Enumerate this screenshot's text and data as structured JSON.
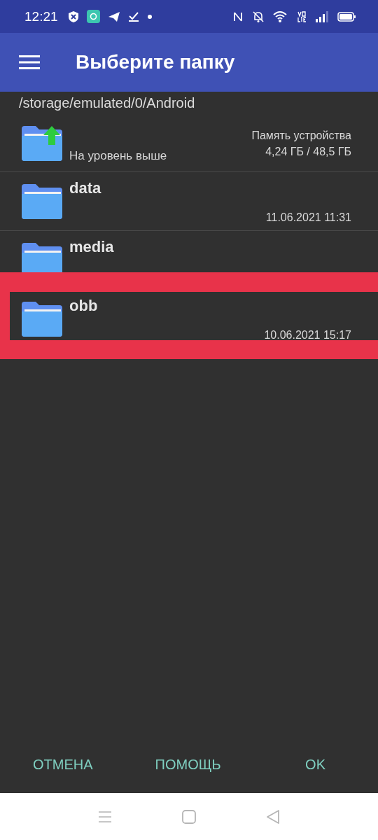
{
  "status_bar": {
    "time": "12:21"
  },
  "app_bar": {
    "title": "Выберите папку"
  },
  "path": "/storage/emulated/0/Android",
  "up_row": {
    "label": "На уровень выше",
    "storage_label": "Память устройства",
    "storage_usage": "4,24 ГБ / 48,5 ГБ"
  },
  "folders": [
    {
      "name": "data",
      "modified": "11.06.2021 11:31",
      "highlighted": false
    },
    {
      "name": "media",
      "highlighted": false
    },
    {
      "name": "obb",
      "modified": "10.06.2021 15:17",
      "highlighted": true
    }
  ],
  "buttons": [
    "ОТМЕНА",
    "ПОМОЩЬ",
    "OK"
  ]
}
